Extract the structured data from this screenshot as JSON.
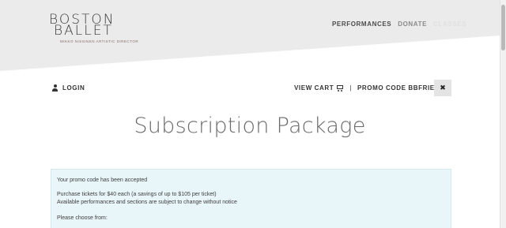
{
  "logo": {
    "line1": "BOSTON",
    "line2": "BALLET",
    "tagline": "MIKKO NISSINEN ARTISTIC DIRECTOR"
  },
  "nav": {
    "items": [
      "PERFORMANCES",
      "DONATE",
      "CLASSES"
    ]
  },
  "account": {
    "login_label": "LOGIN"
  },
  "cart": {
    "view_cart_label": "VIEW CART",
    "separator": "|",
    "promo_label": "PROMO CODE BBFRIENDS",
    "close_symbol": "✖"
  },
  "page": {
    "title": "Subscription Package"
  },
  "promo_message": {
    "accepted": "Your promo code has been accepted",
    "offer": "Purchase tickets for $40 each (a savings of up to $105 per ticket)",
    "notice": "Available performances and sections are subject to change without notice",
    "choose": "Please choose from:"
  }
}
